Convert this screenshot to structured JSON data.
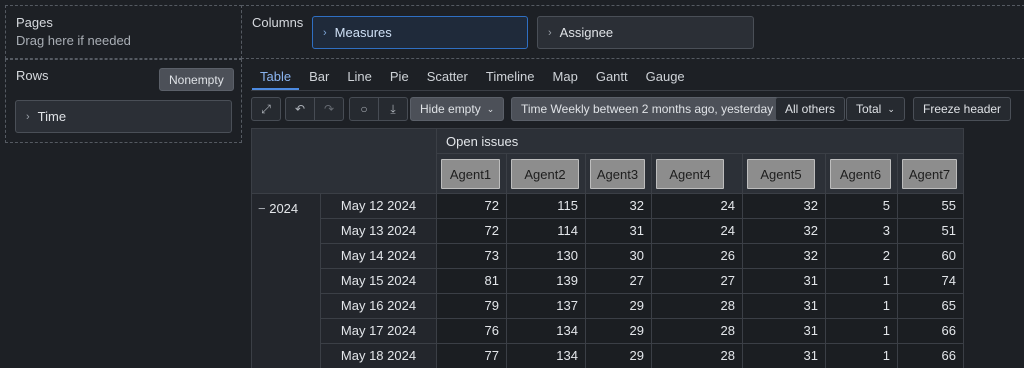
{
  "pages": {
    "title": "Pages",
    "hint": "Drag here if needed"
  },
  "rows": {
    "title": "Rows",
    "nonempty_label": "Nonempty",
    "dimension": "Time"
  },
  "columns": {
    "title": "Columns",
    "dimensions": [
      "Measures",
      "Assignee"
    ]
  },
  "tabs": [
    "Table",
    "Bar",
    "Line",
    "Pie",
    "Scatter",
    "Timeline",
    "Map",
    "Gantt",
    "Gauge"
  ],
  "selected_tab": "Table",
  "toolbar": {
    "hide_empty": "Hide empty",
    "time_filter": "Time Weekly between 2 months ago, yesterday",
    "all_others": "All others",
    "total": "Total",
    "freeze_header": "Freeze header"
  },
  "table": {
    "measure": "Open issues",
    "year_label": "2024",
    "columns": [
      "Agent1",
      "Agent2",
      "Agent3",
      "Agent4",
      "Agent5",
      "Agent6",
      "Agent7"
    ],
    "rows": [
      {
        "date": "May 12 2024",
        "values": [
          72,
          115,
          32,
          24,
          32,
          5,
          55
        ]
      },
      {
        "date": "May 13 2024",
        "values": [
          72,
          114,
          31,
          24,
          32,
          3,
          51
        ]
      },
      {
        "date": "May 14 2024",
        "values": [
          73,
          130,
          30,
          26,
          32,
          2,
          60
        ]
      },
      {
        "date": "May 15 2024",
        "values": [
          81,
          139,
          27,
          27,
          31,
          1,
          74
        ]
      },
      {
        "date": "May 16 2024",
        "values": [
          79,
          137,
          29,
          28,
          31,
          1,
          65
        ]
      },
      {
        "date": "May 17 2024",
        "values": [
          76,
          134,
          29,
          28,
          31,
          1,
          66
        ]
      },
      {
        "date": "May 18 2024",
        "values": [
          77,
          134,
          29,
          28,
          31,
          1,
          66
        ]
      }
    ]
  },
  "colors": {
    "accent": "#4d8ae0",
    "chip": "#8d8d8d",
    "background": "#1d2025"
  }
}
